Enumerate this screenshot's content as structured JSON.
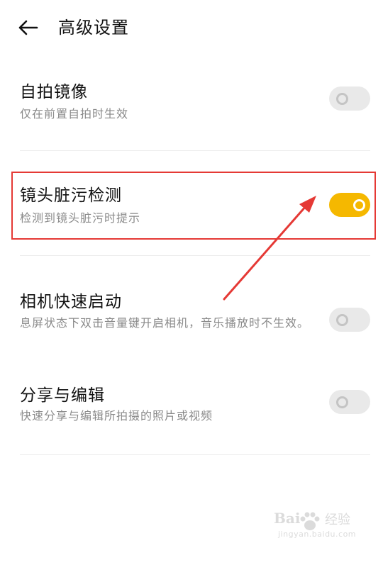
{
  "header": {
    "title": "高级设置",
    "back_icon": "arrow-left-icon"
  },
  "settings": [
    {
      "title": "自拍镜像",
      "description": "仅在前置自拍时生效",
      "enabled": false
    },
    {
      "title": "镜头脏污检测",
      "description": "检测到镜头脏污时提示",
      "enabled": true
    },
    {
      "title": "相机快速启动",
      "description": "息屏状态下双击音量键开启相机，音乐播放时不生效。",
      "enabled": false
    },
    {
      "title": "分享与编辑",
      "description": "快速分享与编辑所拍摄的照片或视频",
      "enabled": false
    }
  ],
  "colors": {
    "toggle_on": "#f5b800",
    "toggle_off": "#e9e9e9",
    "annotation": "#e53935"
  },
  "watermark": {
    "brand": "Bai",
    "brand2": "经验",
    "url": "jingyan.baidu.com"
  }
}
